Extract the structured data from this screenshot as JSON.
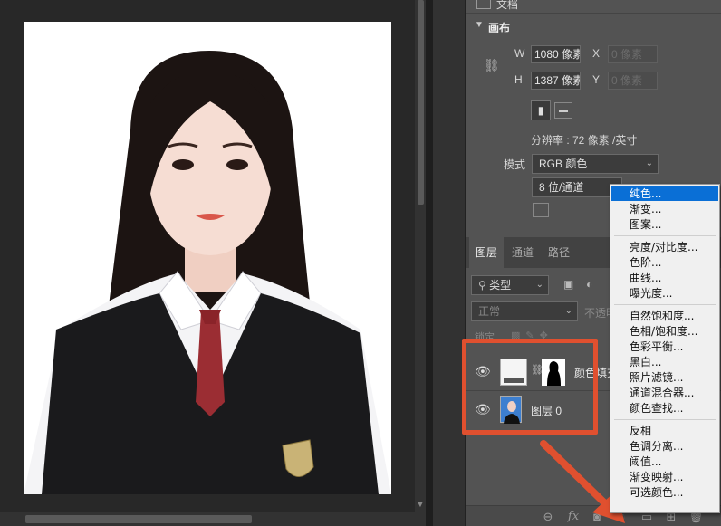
{
  "properties": {
    "partial_top_label": "文档",
    "section_title": "画布",
    "w_label": "W",
    "w_value": "1080 像素",
    "x_label": "X",
    "x_placeholder": "0 像素",
    "h_label": "H",
    "h_value": "1387 像素",
    "y_label": "Y",
    "y_placeholder": "0 像素",
    "resolution": "分辨率 : 72 像素 /英寸",
    "mode_label": "模式",
    "mode_value": "RGB 颜色",
    "depth_value": "8 位/通道"
  },
  "layers_panel": {
    "tabs": [
      "图层",
      "通道",
      "路径"
    ],
    "filter_value": "类型",
    "blend_mode": "正常",
    "opacity_label": "不透明",
    "lock_label": "锁定",
    "layers": [
      {
        "name": "颜色填充",
        "visible": true
      },
      {
        "name": "图层 0",
        "visible": true
      }
    ],
    "bottom_icons": [
      "link-icon",
      "fx-icon",
      "mask-icon",
      "adjustment-icon",
      "folder-icon",
      "new-layer-icon",
      "trash-icon"
    ],
    "fx_label": "fx"
  },
  "adjustment_menu": {
    "groups": [
      [
        "纯色...",
        "渐变...",
        "图案..."
      ],
      [
        "亮度/对比度...",
        "色阶...",
        "曲线...",
        "曝光度..."
      ],
      [
        "自然饱和度...",
        "色相/饱和度...",
        "色彩平衡...",
        "黑白...",
        "照片滤镜...",
        "通道混合器...",
        "颜色查找..."
      ],
      [
        "反相",
        "色调分离...",
        "阈值...",
        "渐变映射...",
        "可选颜色..."
      ]
    ],
    "highlighted": "纯色..."
  },
  "colors": {
    "highlight": "#0a6fd6",
    "annotation": "#e0502f",
    "panel": "#535353"
  }
}
